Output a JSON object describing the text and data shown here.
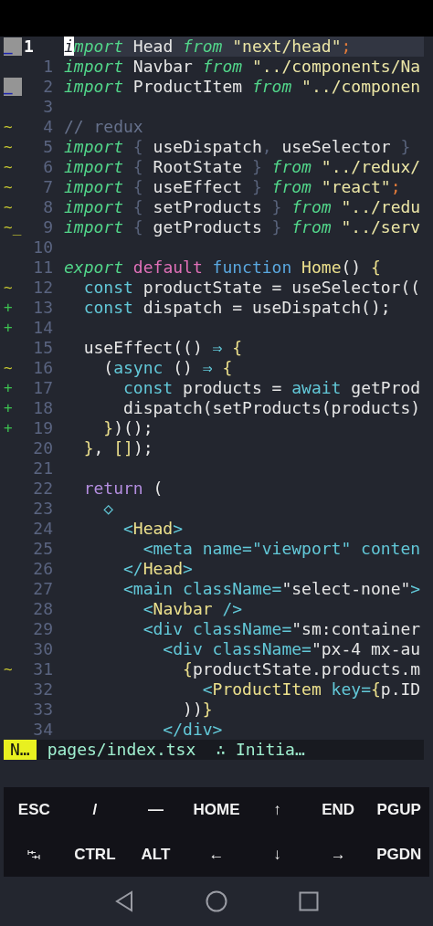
{
  "editor": {
    "lines": [
      {
        "sign": {
          "text": "_",
          "kind": "block"
        },
        "number": "1",
        "current": true,
        "tokens": [
          {
            "text": "i",
            "kind": "cursor"
          },
          {
            "text": "mport",
            "kind": "kw"
          },
          {
            "text": " Head ",
            "kind": "id"
          },
          {
            "text": "from",
            "kind": "kw"
          },
          {
            "text": " \"next/head\"",
            "kind": "str"
          },
          {
            "text": ";",
            "kind": "semi"
          }
        ]
      },
      {
        "number": "1",
        "current": false,
        "tokens": [
          {
            "text": "import",
            "kind": "kw"
          },
          {
            "text": " Navbar ",
            "kind": "id"
          },
          {
            "text": "from",
            "kind": "kw"
          },
          {
            "text": " \"../components/Na",
            "kind": "str"
          }
        ]
      },
      {
        "sign": {
          "text": "_",
          "kind": "block"
        },
        "number": "2",
        "current": false,
        "tokens": [
          {
            "text": "import",
            "kind": "kw"
          },
          {
            "text": " ProductItem ",
            "kind": "id"
          },
          {
            "text": "from",
            "kind": "kw"
          },
          {
            "text": " \"../componen",
            "kind": "str"
          }
        ]
      },
      {
        "number": "3",
        "current": false
      },
      {
        "sign": {
          "text": "~",
          "kind": "changed"
        },
        "number": "4",
        "current": false,
        "tokens": [
          {
            "text": "// redux",
            "kind": "comment"
          }
        ]
      },
      {
        "sign": {
          "text": "~",
          "kind": "changed"
        },
        "number": "5",
        "current": false,
        "tokens": [
          {
            "text": "import",
            "kind": "kw"
          },
          {
            "text": " { ",
            "kind": "brace"
          },
          {
            "text": "useDispatch",
            "kind": "id"
          },
          {
            "text": ", ",
            "kind": "brace"
          },
          {
            "text": "useSelector",
            "kind": "id"
          },
          {
            "text": " }",
            "kind": "brace"
          }
        ]
      },
      {
        "sign": {
          "text": "~",
          "kind": "changed"
        },
        "number": "6",
        "current": false,
        "tokens": [
          {
            "text": "import",
            "kind": "kw"
          },
          {
            "text": " { ",
            "kind": "brace"
          },
          {
            "text": "RootState",
            "kind": "id"
          },
          {
            "text": " } ",
            "kind": "brace"
          },
          {
            "text": "from",
            "kind": "kw"
          },
          {
            "text": " \"../redux/",
            "kind": "str"
          }
        ]
      },
      {
        "sign": {
          "text": "~",
          "kind": "changed"
        },
        "number": "7",
        "current": false,
        "tokens": [
          {
            "text": "import",
            "kind": "kw"
          },
          {
            "text": " { ",
            "kind": "brace"
          },
          {
            "text": "useEffect",
            "kind": "id"
          },
          {
            "text": " } ",
            "kind": "brace"
          },
          {
            "text": "from",
            "kind": "kw"
          },
          {
            "text": " \"react\"",
            "kind": "str"
          },
          {
            "text": ";",
            "kind": "semi"
          }
        ]
      },
      {
        "sign": {
          "text": "~",
          "kind": "changed"
        },
        "number": "8",
        "current": false,
        "tokens": [
          {
            "text": "import",
            "kind": "kw"
          },
          {
            "text": " { ",
            "kind": "brace"
          },
          {
            "text": "setProducts",
            "kind": "id"
          },
          {
            "text": " } ",
            "kind": "brace"
          },
          {
            "text": "from",
            "kind": "kw"
          },
          {
            "text": " \"../redu",
            "kind": "str"
          }
        ]
      },
      {
        "sign": {
          "text": "~_",
          "kind": "changed"
        },
        "number": "9",
        "current": false,
        "tokens": [
          {
            "text": "import",
            "kind": "kw"
          },
          {
            "text": " { ",
            "kind": "brace"
          },
          {
            "text": "getProducts",
            "kind": "id"
          },
          {
            "text": " } ",
            "kind": "brace"
          },
          {
            "text": "from",
            "kind": "kw"
          },
          {
            "text": " \"../serv",
            "kind": "str"
          }
        ]
      },
      {
        "number": "10",
        "current": false
      },
      {
        "number": "11",
        "current": false,
        "tokens": [
          {
            "text": "export",
            "kind": "kw"
          },
          {
            "text": " default",
            "kind": "pink"
          },
          {
            "text": " function",
            "kind": "blue"
          },
          {
            "text": " Home",
            "kind": "yellow"
          },
          {
            "text": "() ",
            "kind": "id"
          },
          {
            "text": "{",
            "kind": "yellow"
          }
        ]
      },
      {
        "sign": {
          "text": "~",
          "kind": "changed"
        },
        "number": "12",
        "current": false,
        "tokens": [
          {
            "text": "  const",
            "kind": "cyan"
          },
          {
            "text": " productState = useSelector((",
            "kind": "id"
          }
        ]
      },
      {
        "sign": {
          "text": "+",
          "kind": "added"
        },
        "number": "13",
        "current": false,
        "tokens": [
          {
            "text": "  const",
            "kind": "cyan"
          },
          {
            "text": " dispatch = useDispatch();",
            "kind": "id"
          }
        ]
      },
      {
        "sign": {
          "text": "+",
          "kind": "added"
        },
        "number": "14",
        "current": false
      },
      {
        "number": "15",
        "current": false,
        "tokens": [
          {
            "text": "  useEffect(() ",
            "kind": "id"
          },
          {
            "text": "⇒",
            "kind": "cyan"
          },
          {
            "text": " {",
            "kind": "yellow"
          }
        ]
      },
      {
        "sign": {
          "text": "~",
          "kind": "changed"
        },
        "number": "16",
        "current": false,
        "tokens": [
          {
            "text": "    (",
            "kind": "id"
          },
          {
            "text": "async",
            "kind": "cyan"
          },
          {
            "text": " () ",
            "kind": "id"
          },
          {
            "text": "⇒",
            "kind": "cyan"
          },
          {
            "text": " {",
            "kind": "yellow"
          }
        ]
      },
      {
        "sign": {
          "text": "+",
          "kind": "added"
        },
        "number": "17",
        "current": false,
        "tokens": [
          {
            "text": "      const",
            "kind": "cyan"
          },
          {
            "text": " products = ",
            "kind": "id"
          },
          {
            "text": "await",
            "kind": "cyan"
          },
          {
            "text": " getProd",
            "kind": "id"
          }
        ]
      },
      {
        "sign": {
          "text": "+",
          "kind": "added"
        },
        "number": "18",
        "current": false,
        "tokens": [
          {
            "text": "      dispatch(setProducts(products)",
            "kind": "id"
          }
        ]
      },
      {
        "sign": {
          "text": "+",
          "kind": "added"
        },
        "number": "19",
        "current": false,
        "tokens": [
          {
            "text": "    }",
            "kind": "yellow"
          },
          {
            "text": ")();",
            "kind": "id"
          }
        ]
      },
      {
        "number": "20",
        "current": false,
        "tokens": [
          {
            "text": "  }",
            "kind": "yellow"
          },
          {
            "text": ", ",
            "kind": "id"
          },
          {
            "text": "[]",
            "kind": "yellow"
          },
          {
            "text": ");",
            "kind": "id"
          }
        ]
      },
      {
        "number": "21",
        "current": false
      },
      {
        "number": "22",
        "current": false,
        "tokens": [
          {
            "text": "  return",
            "kind": "purple"
          },
          {
            "text": " (",
            "kind": "id"
          }
        ]
      },
      {
        "number": "23",
        "current": false,
        "tokens": [
          {
            "text": "    ◇",
            "kind": "cyan"
          }
        ]
      },
      {
        "number": "24",
        "current": false,
        "tokens": [
          {
            "text": "      <",
            "kind": "cyan"
          },
          {
            "text": "Head",
            "kind": "yellow"
          },
          {
            "text": ">",
            "kind": "cyan"
          }
        ]
      },
      {
        "number": "25",
        "current": false,
        "tokens": [
          {
            "text": "        <meta name=\"viewport\" conten",
            "kind": "cyan"
          }
        ]
      },
      {
        "number": "26",
        "current": false,
        "tokens": [
          {
            "text": "      </",
            "kind": "cyan"
          },
          {
            "text": "Head",
            "kind": "yellow"
          },
          {
            "text": ">",
            "kind": "cyan"
          }
        ]
      },
      {
        "number": "27",
        "current": false,
        "tokens": [
          {
            "text": "      <main className=",
            "kind": "cyan"
          },
          {
            "text": "\"select-none\"",
            "kind": "id"
          },
          {
            "text": ">",
            "kind": "cyan"
          }
        ]
      },
      {
        "number": "28",
        "current": false,
        "tokens": [
          {
            "text": "        <",
            "kind": "cyan"
          },
          {
            "text": "Navbar",
            "kind": "yellow"
          },
          {
            "text": " />",
            "kind": "cyan"
          }
        ]
      },
      {
        "number": "29",
        "current": false,
        "tokens": [
          {
            "text": "        <div className=",
            "kind": "cyan"
          },
          {
            "text": "\"sm:container",
            "kind": "id"
          }
        ]
      },
      {
        "number": "30",
        "current": false,
        "tokens": [
          {
            "text": "          <div className=",
            "kind": "cyan"
          },
          {
            "text": "\"px-4 mx-au",
            "kind": "id"
          }
        ]
      },
      {
        "sign": {
          "text": "~",
          "kind": "changed"
        },
        "number": "31",
        "current": false,
        "tokens": [
          {
            "text": "            {",
            "kind": "yellow"
          },
          {
            "text": "productState.products.m",
            "kind": "id"
          }
        ]
      },
      {
        "number": "32",
        "current": false,
        "tokens": [
          {
            "text": "              <",
            "kind": "cyan"
          },
          {
            "text": "ProductItem",
            "kind": "yellow"
          },
          {
            "text": " key=",
            "kind": "cyan"
          },
          {
            "text": "{",
            "kind": "yellow"
          },
          {
            "text": "p.ID",
            "kind": "id"
          }
        ]
      },
      {
        "number": "33",
        "current": false,
        "tokens": [
          {
            "text": "            ))",
            "kind": "id"
          },
          {
            "text": "}",
            "kind": "yellow"
          }
        ]
      },
      {
        "number": "34",
        "current": false,
        "tokens": [
          {
            "text": "          </div>",
            "kind": "cyan"
          }
        ]
      }
    ]
  },
  "status_line": {
    "mode": "N…",
    "file": "pages/index.tsx",
    "info": "∴ Initia…"
  },
  "extra_keys": [
    {
      "kind": "text",
      "label": "ESC"
    },
    {
      "kind": "text",
      "label": "/"
    },
    {
      "kind": "text",
      "label": "—"
    },
    {
      "kind": "text",
      "label": "HOME"
    },
    {
      "kind": "text",
      "label": "↑"
    },
    {
      "kind": "text",
      "label": "END"
    },
    {
      "kind": "text",
      "label": "PGUP"
    },
    {
      "kind": "icon"
    },
    {
      "kind": "text",
      "label": "CTRL"
    },
    {
      "kind": "text",
      "label": "ALT"
    },
    {
      "kind": "text",
      "label": "←"
    },
    {
      "kind": "text",
      "label": "↓"
    },
    {
      "kind": "text",
      "label": "→"
    },
    {
      "kind": "text",
      "label": "PGDN"
    }
  ]
}
